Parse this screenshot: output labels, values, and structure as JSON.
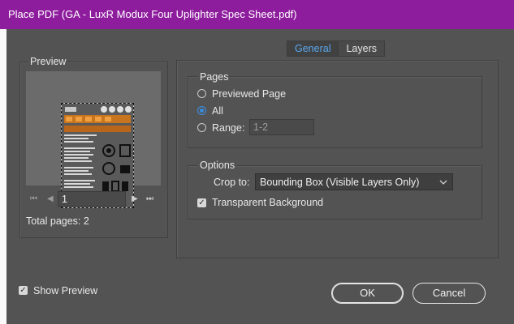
{
  "window": {
    "title": "Place PDF (GA - LuxR Modux Four Uplighter Spec Sheet.pdf)"
  },
  "tabs": [
    {
      "label": "General",
      "active": true
    },
    {
      "label": "Layers",
      "active": false
    }
  ],
  "preview": {
    "label": "Preview",
    "page_value": "1",
    "total_pages": "Total pages: 2",
    "nav": {
      "first": "⏮",
      "prev": "◀",
      "next": "▶",
      "last": "⏭"
    }
  },
  "pages": {
    "label": "Pages",
    "options": [
      {
        "label": "Previewed Page",
        "checked": false
      },
      {
        "label": "All",
        "checked": true
      },
      {
        "label": "Range:",
        "checked": false
      }
    ],
    "range_value": "1-2"
  },
  "options": {
    "label": "Options",
    "crop_label": "Crop to:",
    "crop_value": "Bounding Box (Visible Layers Only)",
    "transparent_label": "Transparent Background",
    "transparent_checked": true
  },
  "show_preview": {
    "label": "Show Preview",
    "checked": true
  },
  "buttons": {
    "ok": "OK",
    "cancel": "Cancel"
  },
  "colors": {
    "titlebar": "#8e1d9e",
    "dialog_bg": "#535353",
    "accent": "#3b8de0"
  }
}
